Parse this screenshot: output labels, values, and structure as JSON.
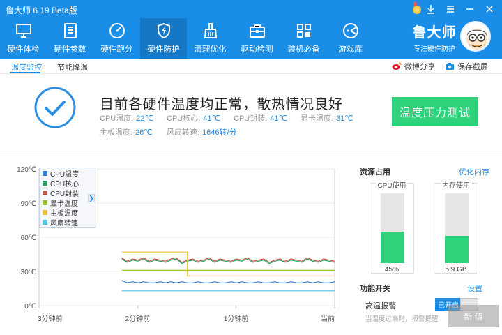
{
  "app": {
    "title": "鲁大师 6.19 Beta版"
  },
  "nav": [
    {
      "label": "硬件体检",
      "icon": "monitor-icon"
    },
    {
      "label": "硬件参数",
      "icon": "document-list-icon"
    },
    {
      "label": "硬件跑分",
      "icon": "speedometer-icon"
    },
    {
      "label": "硬件防护",
      "icon": "shield-bolt-icon",
      "active": true
    },
    {
      "label": "清理优化",
      "icon": "broom-icon"
    },
    {
      "label": "驱动检测",
      "icon": "toolbox-icon"
    },
    {
      "label": "装机必备",
      "icon": "apps-grid-icon"
    },
    {
      "label": "游戏库",
      "icon": "gamepad-icon"
    }
  ],
  "brand": {
    "name": "鲁大师",
    "subtitle": "专注硬件防护"
  },
  "subtabs": [
    {
      "label": "温度监控",
      "active": true
    },
    {
      "label": "节能降温",
      "active": false
    }
  ],
  "actions": {
    "share": "微博分享",
    "screenshot": "保存截屏"
  },
  "status": {
    "headline": "目前各硬件温度均正常，散热情况良好",
    "readings": [
      {
        "label": "CPU温度:",
        "value": "22℃"
      },
      {
        "label": "CPU核心:",
        "value": "41℃"
      },
      {
        "label": "CPU封装:",
        "value": "41℃"
      },
      {
        "label": "显卡温度:",
        "value": "31℃"
      },
      {
        "label": "主板温度:",
        "value": "26℃"
      },
      {
        "label": "风扇转速:",
        "value": "1646转/分"
      }
    ],
    "stress_button": "温度压力测试"
  },
  "chart_data": {
    "type": "line",
    "y_ticks": [
      "120℃",
      "90℃",
      "60℃",
      "30℃",
      "0℃"
    ],
    "ylim": [
      0,
      120
    ],
    "x_ticks": [
      "3分钟前",
      "2分钟前",
      "1分钟前",
      "当前"
    ],
    "grid": true,
    "legend_position": "top-left",
    "series": [
      {
        "name": "CPU温度",
        "color": "#2f7fd6",
        "start": 0.28,
        "values": [
          22,
          20,
          21,
          20,
          21,
          20,
          20,
          21,
          20,
          21,
          20,
          21,
          20,
          20,
          21,
          20,
          20,
          21,
          20,
          20,
          21,
          20,
          21,
          20,
          20,
          21,
          20,
          20,
          21,
          20,
          20,
          21,
          20,
          20,
          21,
          20,
          21,
          20,
          20,
          21
        ]
      },
      {
        "name": "CPU核心",
        "color": "#2aa061",
        "start": 0.28,
        "values": [
          41,
          38,
          40,
          39,
          41,
          38,
          40,
          39,
          38,
          40,
          41,
          37,
          39,
          40,
          38,
          39,
          41,
          38,
          40,
          39,
          38,
          40,
          39,
          41,
          38,
          39,
          40,
          37,
          39,
          40,
          38,
          40,
          39,
          38,
          41,
          39,
          38,
          40,
          39,
          38
        ]
      },
      {
        "name": "CPU封装",
        "color": "#c0584a",
        "start": 0.28,
        "values": [
          42,
          39,
          41,
          40,
          42,
          39,
          41,
          40,
          39,
          41,
          42,
          38,
          40,
          41,
          39,
          40,
          42,
          39,
          41,
          40,
          39,
          41,
          40,
          42,
          39,
          40,
          41,
          38,
          40,
          41,
          39,
          41,
          40,
          39,
          42,
          40,
          39,
          41,
          40,
          39
        ]
      },
      {
        "name": "显卡温度",
        "color": "#9ac22a",
        "start": 0.28,
        "values": [
          31,
          31,
          31,
          31,
          31,
          31,
          31,
          31,
          31,
          31,
          31,
          31,
          31,
          31,
          31,
          31,
          31,
          31,
          31,
          31,
          31,
          31,
          31,
          31,
          31,
          31,
          31,
          31,
          31,
          31,
          31,
          31,
          31,
          31,
          31,
          31,
          31,
          31,
          31,
          31
        ]
      },
      {
        "name": "主板温度",
        "color": "#e8c22c",
        "start": 0.28,
        "values": [
          47,
          47,
          47,
          47,
          47,
          47,
          47,
          47,
          47,
          47,
          47,
          47,
          26,
          26,
          26,
          26,
          26,
          26,
          26,
          26,
          26,
          26,
          26,
          26,
          26,
          26,
          26,
          26,
          26,
          26,
          26,
          26,
          26,
          26,
          26,
          26,
          26,
          26,
          26,
          26
        ]
      },
      {
        "name": "风扇转速",
        "color": "#4cc3e8",
        "start": 0.28,
        "values": [
          13,
          13,
          13,
          13,
          13,
          13,
          13,
          13,
          13,
          13,
          13,
          13,
          13,
          13,
          13,
          13,
          13,
          13,
          13,
          13,
          13,
          13,
          13,
          13,
          13,
          13,
          13,
          13,
          13,
          13,
          13,
          13,
          13,
          13,
          13,
          13,
          13,
          13,
          13,
          13
        ]
      }
    ]
  },
  "resources": {
    "title": "资源占用",
    "optimize": "优化内存",
    "cpu": {
      "label": "CPU使用",
      "percent": 45,
      "value_text": "45%"
    },
    "memory": {
      "label": "内存使用",
      "percent": 39,
      "value_text": "5.9 GB"
    }
  },
  "functions": {
    "title": "功能开关",
    "settings": "设置",
    "alarm_label": "高温报警",
    "alarm_note": "当温度过高时，报警提醒",
    "toggle_text": "已开启"
  },
  "watermark": "新 值"
}
